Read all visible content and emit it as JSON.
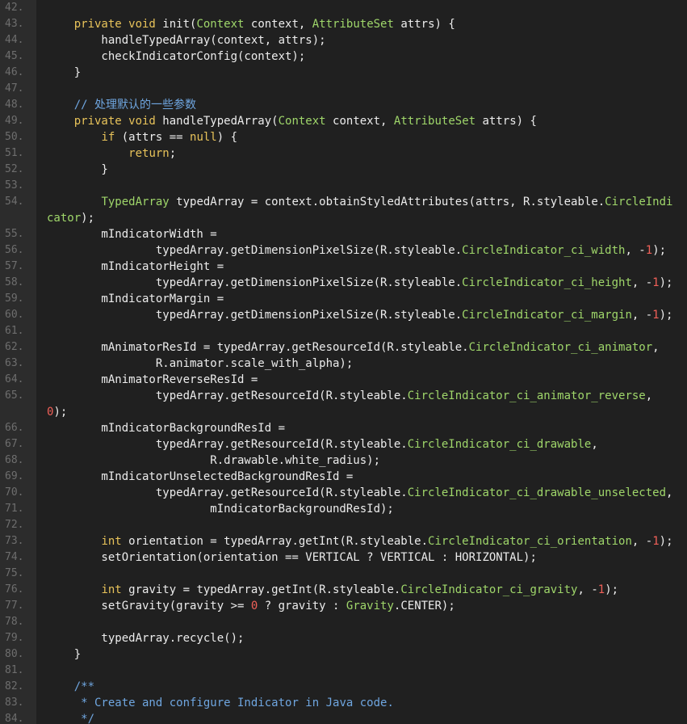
{
  "editor": {
    "colors": {
      "background": "#202020",
      "gutter": "#2c2c2c",
      "line_number": "#6e6e6e",
      "plain_text": "#ececec",
      "keyword": "#e8c35a",
      "type_and_resource": "#9fd66a",
      "comment": "#6fa6e0",
      "number": "#f06058"
    },
    "lines": [
      {
        "n": "42.",
        "t": []
      },
      {
        "n": "43.",
        "t": [
          [
            "    "
          ],
          [
            "private void",
            "kw"
          ],
          [
            " init("
          ],
          [
            "Context",
            "ty"
          ],
          [
            " context, "
          ],
          [
            "AttributeSet",
            "ty"
          ],
          [
            " attrs) {"
          ]
        ]
      },
      {
        "n": "44.",
        "t": [
          [
            "        handleTypedArray(context, attrs);"
          ]
        ]
      },
      {
        "n": "45.",
        "t": [
          [
            "        checkIndicatorConfig(context);"
          ]
        ]
      },
      {
        "n": "46.",
        "t": [
          [
            "    }"
          ]
        ]
      },
      {
        "n": "47.",
        "t": []
      },
      {
        "n": "48.",
        "t": [
          [
            "    "
          ],
          [
            "// 处理默认的一些参数",
            "cm"
          ]
        ]
      },
      {
        "n": "49.",
        "t": [
          [
            "    "
          ],
          [
            "private void",
            "kw"
          ],
          [
            " handleTypedArray("
          ],
          [
            "Context",
            "ty"
          ],
          [
            " context, "
          ],
          [
            "AttributeSet",
            "ty"
          ],
          [
            " attrs) {"
          ]
        ]
      },
      {
        "n": "50.",
        "t": [
          [
            "        "
          ],
          [
            "if",
            "kw"
          ],
          [
            " (attrs == "
          ],
          [
            "null",
            "kw"
          ],
          [
            ") {"
          ]
        ]
      },
      {
        "n": "51.",
        "t": [
          [
            "            "
          ],
          [
            "return",
            "kw"
          ],
          [
            ";"
          ]
        ]
      },
      {
        "n": "52.",
        "t": [
          [
            "        }"
          ]
        ]
      },
      {
        "n": "53.",
        "t": []
      },
      {
        "n": "54.",
        "t": [
          [
            "        "
          ],
          [
            "TypedArray",
            "ty"
          ],
          [
            " typedArray = context.obtainStyledAttributes(attrs, R.styleable."
          ],
          [
            "CircleIndi",
            "ty"
          ]
        ]
      },
      {
        "n": "",
        "t": [
          [
            "cator",
            "ty"
          ],
          [
            ");"
          ]
        ]
      },
      {
        "n": "55.",
        "t": [
          [
            "        mIndicatorWidth ="
          ]
        ]
      },
      {
        "n": "56.",
        "t": [
          [
            "                typedArray.getDimensionPixelSize(R.styleable."
          ],
          [
            "CircleIndicator_ci_width",
            "ty"
          ],
          [
            ", -"
          ],
          [
            "1",
            "nm"
          ],
          [
            ");"
          ]
        ]
      },
      {
        "n": "57.",
        "t": [
          [
            "        mIndicatorHeight ="
          ]
        ]
      },
      {
        "n": "58.",
        "t": [
          [
            "                typedArray.getDimensionPixelSize(R.styleable."
          ],
          [
            "CircleIndicator_ci_height",
            "ty"
          ],
          [
            ", -"
          ],
          [
            "1",
            "nm"
          ],
          [
            ");"
          ]
        ]
      },
      {
        "n": "59.",
        "t": [
          [
            "        mIndicatorMargin ="
          ]
        ]
      },
      {
        "n": "60.",
        "t": [
          [
            "                typedArray.getDimensionPixelSize(R.styleable."
          ],
          [
            "CircleIndicator_ci_margin",
            "ty"
          ],
          [
            ", -"
          ],
          [
            "1",
            "nm"
          ],
          [
            ");"
          ]
        ]
      },
      {
        "n": "61.",
        "t": []
      },
      {
        "n": "62.",
        "t": [
          [
            "        mAnimatorResId = typedArray.getResourceId(R.styleable."
          ],
          [
            "CircleIndicator_ci_animator",
            "ty"
          ],
          [
            ","
          ]
        ]
      },
      {
        "n": "63.",
        "t": [
          [
            "                R.animator.scale_with_alpha);"
          ]
        ]
      },
      {
        "n": "64.",
        "t": [
          [
            "        mAnimatorReverseResId ="
          ]
        ]
      },
      {
        "n": "65.",
        "t": [
          [
            "                typedArray.getResourceId(R.styleable."
          ],
          [
            "CircleIndicator_ci_animator_reverse",
            "ty"
          ],
          [
            ","
          ]
        ]
      },
      {
        "n": "",
        "t": [
          [
            "0",
            "nm"
          ],
          [
            ");"
          ]
        ]
      },
      {
        "n": "66.",
        "t": [
          [
            "        mIndicatorBackgroundResId ="
          ]
        ]
      },
      {
        "n": "67.",
        "t": [
          [
            "                typedArray.getResourceId(R.styleable."
          ],
          [
            "CircleIndicator_ci_drawable",
            "ty"
          ],
          [
            ","
          ]
        ]
      },
      {
        "n": "68.",
        "t": [
          [
            "                        R.drawable.white_radius);"
          ]
        ]
      },
      {
        "n": "69.",
        "t": [
          [
            "        mIndicatorUnselectedBackgroundResId ="
          ]
        ]
      },
      {
        "n": "70.",
        "t": [
          [
            "                typedArray.getResourceId(R.styleable."
          ],
          [
            "CircleIndicator_ci_drawable_unselected",
            "ty"
          ],
          [
            ","
          ]
        ]
      },
      {
        "n": "71.",
        "t": [
          [
            "                        mIndicatorBackgroundResId);"
          ]
        ]
      },
      {
        "n": "72.",
        "t": []
      },
      {
        "n": "73.",
        "t": [
          [
            "        "
          ],
          [
            "int",
            "kw"
          ],
          [
            " orientation = typedArray.getInt(R.styleable."
          ],
          [
            "CircleIndicator_ci_orientation",
            "ty"
          ],
          [
            ", -"
          ],
          [
            "1",
            "nm"
          ],
          [
            ");"
          ]
        ]
      },
      {
        "n": "74.",
        "t": [
          [
            "        setOrientation(orientation == VERTICAL ? VERTICAL : HORIZONTAL);"
          ]
        ]
      },
      {
        "n": "75.",
        "t": []
      },
      {
        "n": "76.",
        "t": [
          [
            "        "
          ],
          [
            "int",
            "kw"
          ],
          [
            " gravity = typedArray.getInt(R.styleable."
          ],
          [
            "CircleIndicator_ci_gravity",
            "ty"
          ],
          [
            ", -"
          ],
          [
            "1",
            "nm"
          ],
          [
            ");"
          ]
        ]
      },
      {
        "n": "77.",
        "t": [
          [
            "        setGravity(gravity >= "
          ],
          [
            "0",
            "nm"
          ],
          [
            " ? gravity : "
          ],
          [
            "Gravity",
            "ty"
          ],
          [
            ".CENTER);"
          ]
        ]
      },
      {
        "n": "78.",
        "t": []
      },
      {
        "n": "79.",
        "t": [
          [
            "        typedArray.recycle();"
          ]
        ]
      },
      {
        "n": "80.",
        "t": [
          [
            "    }"
          ]
        ]
      },
      {
        "n": "81.",
        "t": []
      },
      {
        "n": "82.",
        "t": [
          [
            "    "
          ],
          [
            "/**",
            "cm"
          ]
        ]
      },
      {
        "n": "83.",
        "t": [
          [
            "    "
          ],
          [
            " * Create and configure Indicator in Java code.",
            "cm"
          ]
        ]
      },
      {
        "n": "84.",
        "t": [
          [
            "    "
          ],
          [
            " */",
            "cm"
          ]
        ]
      }
    ]
  }
}
